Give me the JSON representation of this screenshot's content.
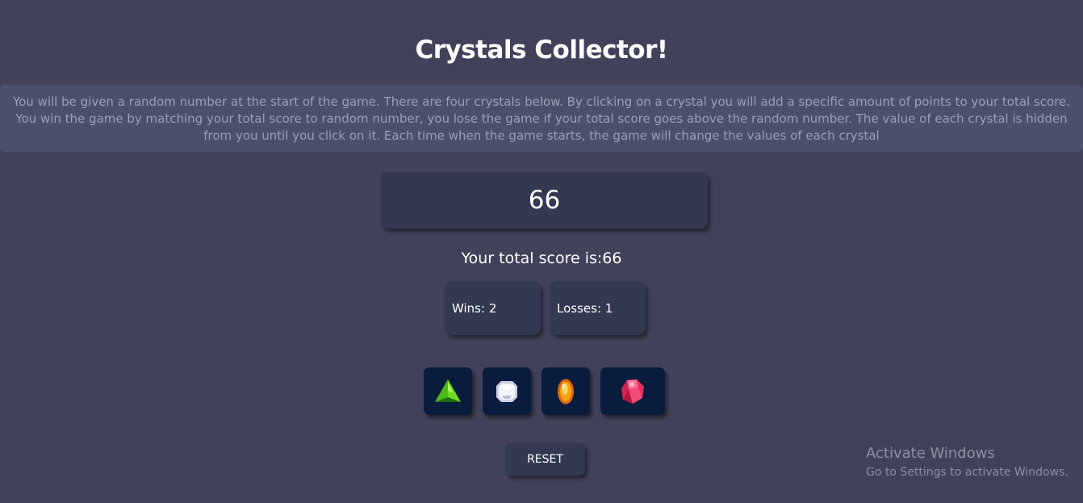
{
  "game": {
    "title": "Crystals Collector!",
    "instructions": "You will be given a random number at the start of the game. There are four crystals below. By clicking on a crystal you will add a specific amount of points to your total score. You win the game by matching your total score to random number, you lose the game if your total score goes above the random number. The value of each crystal is hidden from you until you click on it. Each time when the game starts, the game will change the values of each crystal",
    "target_number": "66",
    "total_score_label": "Your total score is:",
    "total_score_value": "66",
    "wins_label": "Wins: ",
    "wins_value": "2",
    "losses_label": "Losses: ",
    "losses_value": "1",
    "crystals": [
      {
        "icon": "green-crystal-icon",
        "color": "#53c21b"
      },
      {
        "icon": "white-crystal-icon",
        "color": "#e6e6f2"
      },
      {
        "icon": "orange-crystal-icon",
        "color": "#f08a12"
      },
      {
        "icon": "red-crystal-icon",
        "color": "#e2335e"
      }
    ],
    "reset_label": "RESET"
  },
  "watermark": {
    "title": "Activate Windows",
    "subtitle": "Go to Settings to activate Windows."
  },
  "colors": {
    "background": "#41425a",
    "panel": "#333951",
    "crystal_tile": "#0a1c3d",
    "instructions_band": "#4a4f6c"
  }
}
